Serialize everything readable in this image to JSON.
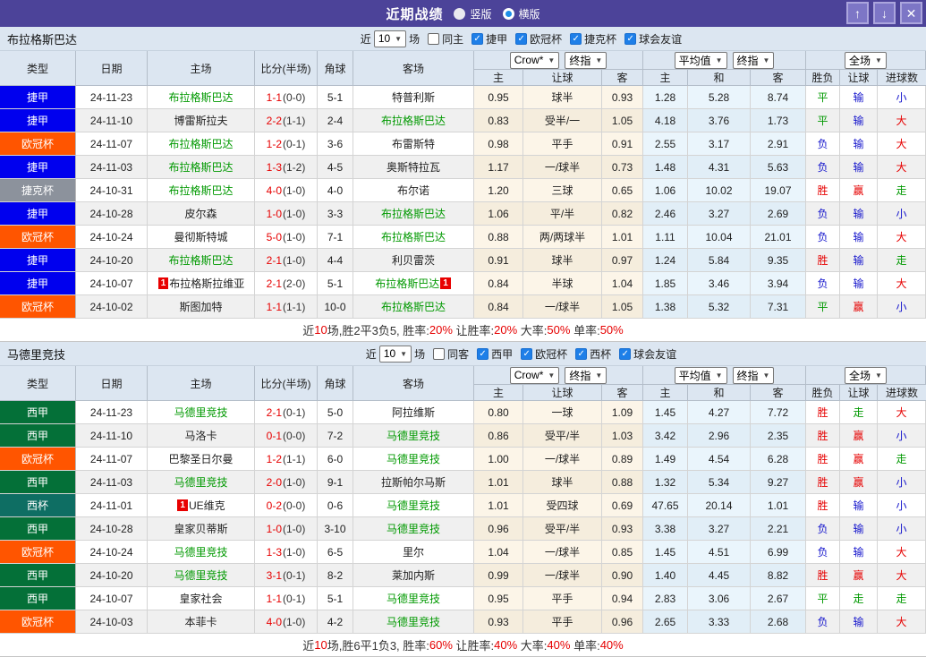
{
  "titlebar": {
    "title": "近期战绩",
    "radios": [
      {
        "label": "竖版",
        "selected": false
      },
      {
        "label": "横版",
        "selected": true
      }
    ],
    "buttons": {
      "up": "↑",
      "down": "↓",
      "close": "✕"
    }
  },
  "header": {
    "cols": [
      "类型",
      "日期",
      "主场",
      "比分(半场)",
      "角球",
      "客场"
    ],
    "group_selects": [
      [
        "Crow*",
        "终指"
      ],
      [
        "平均值",
        "终指"
      ],
      [
        "全场"
      ]
    ],
    "sub_cols": [
      "主",
      "让球",
      "客",
      "主",
      "和",
      "客",
      "胜负",
      "让球",
      "进球数"
    ]
  },
  "type_colors": {
    "捷甲": "#0000ee",
    "欧冠杯": "#ff5500",
    "捷克杯": "#8c929c",
    "西甲": "#047038",
    "西杯": "#0e6e63"
  },
  "colors": {
    "r": "#e60000",
    "g": "#009900",
    "b": "#1515cc",
    "k": "#333333"
  },
  "sections": [
    {
      "team": "布拉格斯巴达",
      "filter": {
        "near_label": "近",
        "matches_value": "10",
        "field_label": "场",
        "same_label": "同主",
        "same_checked": false,
        "leagues": [
          {
            "label": "捷甲",
            "checked": true
          },
          {
            "label": "欧冠杯",
            "checked": true
          },
          {
            "label": "捷克杯",
            "checked": true
          },
          {
            "label": "球会友谊",
            "checked": true
          }
        ]
      },
      "rows": [
        {
          "type": "捷甲",
          "date": "24-11-23",
          "home": {
            "name": "布拉格斯巴达",
            "hl": true
          },
          "ft": "1-1",
          "ht": "(0-0)",
          "corner": "5-1",
          "away": {
            "name": "特普利斯",
            "hl": false
          },
          "odds": [
            "0.95",
            "球半",
            "0.93",
            "1.28",
            "5.28",
            "8.74"
          ],
          "results": [
            [
              "平",
              "g"
            ],
            [
              "输",
              "b"
            ],
            [
              "小",
              "b"
            ]
          ]
        },
        {
          "type": "捷甲",
          "date": "24-11-10",
          "home": {
            "name": "博雷斯拉夫",
            "hl": false
          },
          "ft": "2-2",
          "ht": "(1-1)",
          "corner": "2-4",
          "away": {
            "name": "布拉格斯巴达",
            "hl": true
          },
          "odds": [
            "0.83",
            "受半/一",
            "1.05",
            "4.18",
            "3.76",
            "1.73"
          ],
          "results": [
            [
              "平",
              "g"
            ],
            [
              "输",
              "b"
            ],
            [
              "大",
              "r"
            ]
          ]
        },
        {
          "type": "欧冠杯",
          "date": "24-11-07",
          "home": {
            "name": "布拉格斯巴达",
            "hl": true
          },
          "ft": "1-2",
          "ht": "(0-1)",
          "corner": "3-6",
          "away": {
            "name": "布雷斯特",
            "hl": false
          },
          "odds": [
            "0.98",
            "平手",
            "0.91",
            "2.55",
            "3.17",
            "2.91"
          ],
          "results": [
            [
              "负",
              "b"
            ],
            [
              "输",
              "b"
            ],
            [
              "大",
              "r"
            ]
          ]
        },
        {
          "type": "捷甲",
          "date": "24-11-03",
          "home": {
            "name": "布拉格斯巴达",
            "hl": true
          },
          "ft": "1-3",
          "ht": "(1-2)",
          "corner": "4-5",
          "away": {
            "name": "奥斯特拉瓦",
            "hl": false
          },
          "odds": [
            "1.17",
            "一/球半",
            "0.73",
            "1.48",
            "4.31",
            "5.63"
          ],
          "results": [
            [
              "负",
              "b"
            ],
            [
              "输",
              "b"
            ],
            [
              "大",
              "r"
            ]
          ]
        },
        {
          "type": "捷克杯",
          "date": "24-10-31",
          "home": {
            "name": "布拉格斯巴达",
            "hl": true
          },
          "ft": "4-0",
          "ht": "(1-0)",
          "corner": "4-0",
          "away": {
            "name": "布尔诺",
            "hl": false
          },
          "odds": [
            "1.20",
            "三球",
            "0.65",
            "1.06",
            "10.02",
            "19.07"
          ],
          "results": [
            [
              "胜",
              "r"
            ],
            [
              "赢",
              "r"
            ],
            [
              "走",
              "g"
            ]
          ]
        },
        {
          "type": "捷甲",
          "date": "24-10-28",
          "home": {
            "name": "皮尔森",
            "hl": false
          },
          "ft": "1-0",
          "ht": "(1-0)",
          "corner": "3-3",
          "away": {
            "name": "布拉格斯巴达",
            "hl": true
          },
          "odds": [
            "1.06",
            "平/半",
            "0.82",
            "2.46",
            "3.27",
            "2.69"
          ],
          "results": [
            [
              "负",
              "b"
            ],
            [
              "输",
              "b"
            ],
            [
              "小",
              "b"
            ]
          ]
        },
        {
          "type": "欧冠杯",
          "date": "24-10-24",
          "home": {
            "name": "曼彻斯特城",
            "hl": false
          },
          "ft": "5-0",
          "ht": "(1-0)",
          "corner": "7-1",
          "away": {
            "name": "布拉格斯巴达",
            "hl": true
          },
          "odds": [
            "0.88",
            "两/两球半",
            "1.01",
            "1.11",
            "10.04",
            "21.01"
          ],
          "results": [
            [
              "负",
              "b"
            ],
            [
              "输",
              "b"
            ],
            [
              "大",
              "r"
            ]
          ]
        },
        {
          "type": "捷甲",
          "date": "24-10-20",
          "home": {
            "name": "布拉格斯巴达",
            "hl": true
          },
          "ft": "2-1",
          "ht": "(1-0)",
          "corner": "4-4",
          "away": {
            "name": "利贝雷茨",
            "hl": false
          },
          "odds": [
            "0.91",
            "球半",
            "0.97",
            "1.24",
            "5.84",
            "9.35"
          ],
          "results": [
            [
              "胜",
              "r"
            ],
            [
              "输",
              "b"
            ],
            [
              "走",
              "g"
            ]
          ]
        },
        {
          "type": "捷甲",
          "date": "24-10-07",
          "home": {
            "name": "布拉格斯拉维亚",
            "hl": false,
            "badge": "1",
            "badge_pos": "before"
          },
          "ft": "2-1",
          "ht": "(2-0)",
          "corner": "5-1",
          "away": {
            "name": "布拉格斯巴达",
            "hl": true,
            "badge": "1",
            "badge_pos": "after"
          },
          "odds": [
            "0.84",
            "半球",
            "1.04",
            "1.85",
            "3.46",
            "3.94"
          ],
          "results": [
            [
              "负",
              "b"
            ],
            [
              "输",
              "b"
            ],
            [
              "大",
              "r"
            ]
          ]
        },
        {
          "type": "欧冠杯",
          "date": "24-10-02",
          "home": {
            "name": "斯图加特",
            "hl": false
          },
          "ft": "1-1",
          "ht": "(1-1)",
          "corner": "10-0",
          "away": {
            "name": "布拉格斯巴达",
            "hl": true
          },
          "odds": [
            "0.84",
            "一/球半",
            "1.05",
            "1.38",
            "5.32",
            "7.31"
          ],
          "results": [
            [
              "平",
              "g"
            ],
            [
              "赢",
              "r"
            ],
            [
              "小",
              "b"
            ]
          ]
        }
      ],
      "summary": [
        [
          "近",
          "k"
        ],
        [
          "10",
          "r"
        ],
        [
          "场,胜2平3负5, 胜率:",
          "k"
        ],
        [
          "20%",
          "r"
        ],
        [
          " 让胜率:",
          "k"
        ],
        [
          "20%",
          "r"
        ],
        [
          " 大率:",
          "k"
        ],
        [
          "50%",
          "r"
        ],
        [
          " 单率:",
          "k"
        ],
        [
          "50%",
          "r"
        ]
      ]
    },
    {
      "team": "马德里竞技",
      "filter": {
        "near_label": "近",
        "matches_value": "10",
        "field_label": "场",
        "same_label": "同客",
        "same_checked": false,
        "leagues": [
          {
            "label": "西甲",
            "checked": true
          },
          {
            "label": "欧冠杯",
            "checked": true
          },
          {
            "label": "西杯",
            "checked": true
          },
          {
            "label": "球会友谊",
            "checked": true
          }
        ]
      },
      "rows": [
        {
          "type": "西甲",
          "date": "24-11-23",
          "home": {
            "name": "马德里竞技",
            "hl": true
          },
          "ft": "2-1",
          "ht": "(0-1)",
          "corner": "5-0",
          "away": {
            "name": "阿拉维斯",
            "hl": false
          },
          "odds": [
            "0.80",
            "一球",
            "1.09",
            "1.45",
            "4.27",
            "7.72"
          ],
          "results": [
            [
              "胜",
              "r"
            ],
            [
              "走",
              "g"
            ],
            [
              "大",
              "r"
            ]
          ]
        },
        {
          "type": "西甲",
          "date": "24-11-10",
          "home": {
            "name": "马洛卡",
            "hl": false
          },
          "ft": "0-1",
          "ht": "(0-0)",
          "corner": "7-2",
          "away": {
            "name": "马德里竞技",
            "hl": true
          },
          "odds": [
            "0.86",
            "受平/半",
            "1.03",
            "3.42",
            "2.96",
            "2.35"
          ],
          "results": [
            [
              "胜",
              "r"
            ],
            [
              "赢",
              "r"
            ],
            [
              "小",
              "b"
            ]
          ]
        },
        {
          "type": "欧冠杯",
          "date": "24-11-07",
          "home": {
            "name": "巴黎圣日尔曼",
            "hl": false
          },
          "ft": "1-2",
          "ht": "(1-1)",
          "corner": "6-0",
          "away": {
            "name": "马德里竞技",
            "hl": true
          },
          "odds": [
            "1.00",
            "一/球半",
            "0.89",
            "1.49",
            "4.54",
            "6.28"
          ],
          "results": [
            [
              "胜",
              "r"
            ],
            [
              "赢",
              "r"
            ],
            [
              "走",
              "g"
            ]
          ]
        },
        {
          "type": "西甲",
          "date": "24-11-03",
          "home": {
            "name": "马德里竞技",
            "hl": true
          },
          "ft": "2-0",
          "ht": "(1-0)",
          "corner": "9-1",
          "away": {
            "name": "拉斯帕尔马斯",
            "hl": false
          },
          "odds": [
            "1.01",
            "球半",
            "0.88",
            "1.32",
            "5.34",
            "9.27"
          ],
          "results": [
            [
              "胜",
              "r"
            ],
            [
              "赢",
              "r"
            ],
            [
              "小",
              "b"
            ]
          ]
        },
        {
          "type": "西杯",
          "date": "24-11-01",
          "home": {
            "name": "UE维克",
            "hl": false,
            "badge": "1",
            "badge_pos": "before"
          },
          "ft": "0-2",
          "ht": "(0-0)",
          "corner": "0-6",
          "away": {
            "name": "马德里竞技",
            "hl": true
          },
          "odds": [
            "1.01",
            "受四球",
            "0.69",
            "47.65",
            "20.14",
            "1.01"
          ],
          "results": [
            [
              "胜",
              "r"
            ],
            [
              "输",
              "b"
            ],
            [
              "小",
              "b"
            ]
          ]
        },
        {
          "type": "西甲",
          "date": "24-10-28",
          "home": {
            "name": "皇家贝蒂斯",
            "hl": false
          },
          "ft": "1-0",
          "ht": "(1-0)",
          "corner": "3-10",
          "away": {
            "name": "马德里竞技",
            "hl": true
          },
          "odds": [
            "0.96",
            "受平/半",
            "0.93",
            "3.38",
            "3.27",
            "2.21"
          ],
          "results": [
            [
              "负",
              "b"
            ],
            [
              "输",
              "b"
            ],
            [
              "小",
              "b"
            ]
          ]
        },
        {
          "type": "欧冠杯",
          "date": "24-10-24",
          "home": {
            "name": "马德里竞技",
            "hl": true
          },
          "ft": "1-3",
          "ht": "(1-0)",
          "corner": "6-5",
          "away": {
            "name": "里尔",
            "hl": false
          },
          "odds": [
            "1.04",
            "一/球半",
            "0.85",
            "1.45",
            "4.51",
            "6.99"
          ],
          "results": [
            [
              "负",
              "b"
            ],
            [
              "输",
              "b"
            ],
            [
              "大",
              "r"
            ]
          ]
        },
        {
          "type": "西甲",
          "date": "24-10-20",
          "home": {
            "name": "马德里竞技",
            "hl": true
          },
          "ft": "3-1",
          "ht": "(0-1)",
          "corner": "8-2",
          "away": {
            "name": "莱加内斯",
            "hl": false
          },
          "odds": [
            "0.99",
            "一/球半",
            "0.90",
            "1.40",
            "4.45",
            "8.82"
          ],
          "results": [
            [
              "胜",
              "r"
            ],
            [
              "赢",
              "r"
            ],
            [
              "大",
              "r"
            ]
          ]
        },
        {
          "type": "西甲",
          "date": "24-10-07",
          "home": {
            "name": "皇家社会",
            "hl": false
          },
          "ft": "1-1",
          "ht": "(0-1)",
          "corner": "5-1",
          "away": {
            "name": "马德里竞技",
            "hl": true
          },
          "odds": [
            "0.95",
            "平手",
            "0.94",
            "2.83",
            "3.06",
            "2.67"
          ],
          "results": [
            [
              "平",
              "g"
            ],
            [
              "走",
              "g"
            ],
            [
              "走",
              "g"
            ]
          ]
        },
        {
          "type": "欧冠杯",
          "date": "24-10-03",
          "home": {
            "name": "本菲卡",
            "hl": false
          },
          "ft": "4-0",
          "ht": "(1-0)",
          "corner": "4-2",
          "away": {
            "name": "马德里竞技",
            "hl": true
          },
          "odds": [
            "0.93",
            "平手",
            "0.96",
            "2.65",
            "3.33",
            "2.68"
          ],
          "results": [
            [
              "负",
              "b"
            ],
            [
              "输",
              "b"
            ],
            [
              "大",
              "r"
            ]
          ]
        }
      ],
      "summary": [
        [
          "近",
          "k"
        ],
        [
          "10",
          "r"
        ],
        [
          "场,胜6平1负3, 胜率:",
          "k"
        ],
        [
          "60%",
          "r"
        ],
        [
          " 让胜率:",
          "k"
        ],
        [
          "40%",
          "r"
        ],
        [
          " 大率:",
          "k"
        ],
        [
          "40%",
          "r"
        ],
        [
          " 单率:",
          "k"
        ],
        [
          "40%",
          "r"
        ]
      ]
    }
  ]
}
